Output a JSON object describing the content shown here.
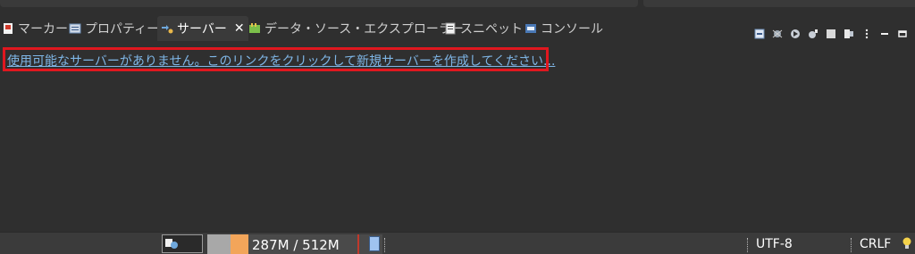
{
  "tabs": [
    {
      "label": "マーカー",
      "icon": "markers-icon",
      "active": false
    },
    {
      "label": "プロパティー",
      "icon": "properties-icon",
      "active": false
    },
    {
      "label": "サーバー",
      "icon": "servers-icon",
      "active": true
    },
    {
      "label": "データ・ソース・エクスプローラー",
      "icon": "data-source-explorer-icon",
      "active": false
    },
    {
      "label": "スニペット",
      "icon": "snippets-icon",
      "active": false
    },
    {
      "label": "コンソール",
      "icon": "console-icon",
      "active": false
    }
  ],
  "toolbar_icons": [
    "collapse-icon",
    "debug-server-icon",
    "start-server-icon",
    "profile-server-icon",
    "stop-server-icon",
    "publish-icon",
    "view-menu-icon",
    "minimize-icon",
    "maximize-icon"
  ],
  "content": {
    "link_text": "使用可能なサーバーがありません。このリンクをクリックして新規サーバーを作成してください..."
  },
  "status": {
    "heap_label": "287M / 512M",
    "heap_used_fraction": 0.56,
    "encoding": "UTF-8",
    "line_ending": "CRLF"
  },
  "colors": {
    "link": "#7fb6e6",
    "highlight": "#e0171f",
    "heap_used": "#f2a55a"
  }
}
